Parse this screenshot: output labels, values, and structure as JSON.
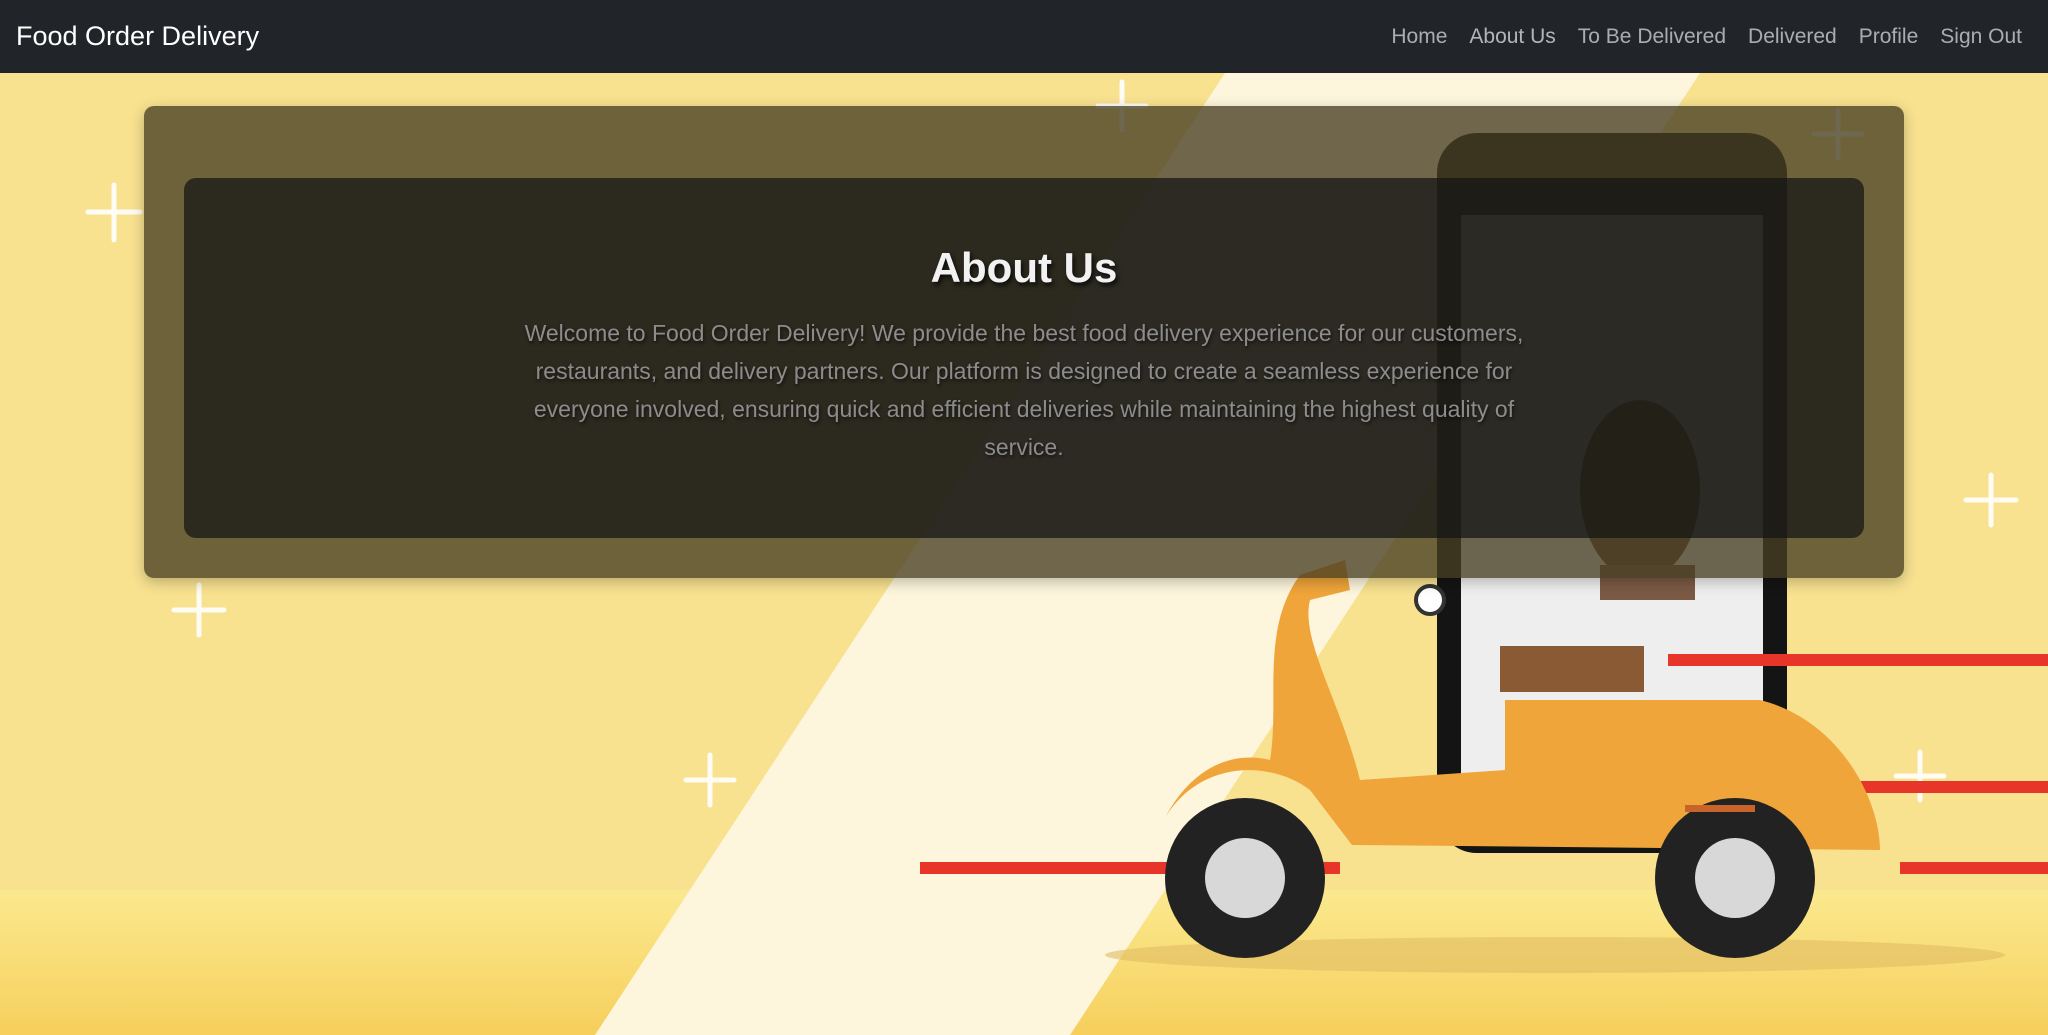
{
  "navbar": {
    "brand": "Food Order Delivery",
    "links": [
      {
        "label": "Home"
      },
      {
        "label": "About Us"
      },
      {
        "label": "To Be Delivered"
      },
      {
        "label": "Delivered"
      },
      {
        "label": "Profile"
      },
      {
        "label": "Sign Out"
      }
    ]
  },
  "about": {
    "title": "About Us",
    "text": "Welcome to Food Order Delivery! We provide the best food delivery experience for our customers, restaurants, and delivery partners. Our platform is designed to create a seamless experience for everyone involved, ensuring quick and efficient deliveries while maintaining the highest quality of service."
  },
  "colors": {
    "navbar_bg": "#212529",
    "background": "#f7e08e",
    "scooter": "#f0a53a",
    "speed_lines": "#e8352a"
  }
}
